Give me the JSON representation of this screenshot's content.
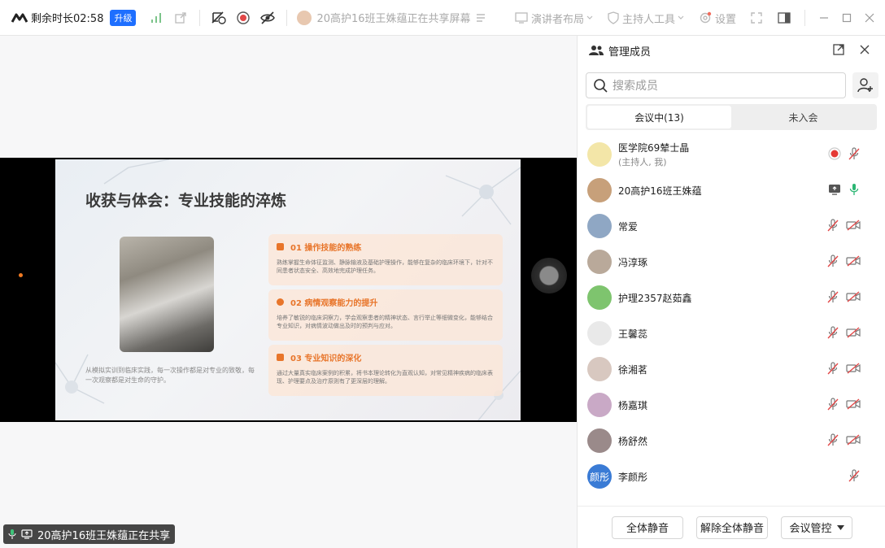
{
  "topbar": {
    "timer": "剩余时长02:58",
    "upgrade": "升级",
    "share_status": "20高护16班王姝蕴正在共享屏幕",
    "presenter_layout": "演讲者布局",
    "host_tools": "主持人工具",
    "settings": "设置"
  },
  "slide": {
    "title": "收获与体会：专业技能的淬炼",
    "caption": "从模拟实训到临床实践，每一次操作都是对专业的致敬，每一次观察都是对生命的守护。",
    "cards": [
      {
        "heading": "01 操作技能的熟练",
        "text": "熟练掌握生命体征监测、静脉输液及基础护理操作，能够在复杂的临床环境下，针对不同患者状态安全、高效地完成护理任务。"
      },
      {
        "heading": "02 病情观察能力的提升",
        "text": "培养了敏锐的临床洞察力，学会观察患者的精神状态、言行举止等细微变化，能够结合专业知识，对病情波动做出及时的预判与应对。"
      },
      {
        "heading": "03 专业知识的深化",
        "text": "通过大量真实临床案例的积累，将书本理论转化为直观认知，对常见精神疾病的临床表现、护理要点及治疗原则有了更深层的理解。"
      }
    ]
  },
  "status_pill": "20高护16班王姝蕴正在共享",
  "sidebar": {
    "title": "管理成员",
    "search_placeholder": "搜索成员",
    "tabs": [
      "会议中(13)",
      "未入会"
    ],
    "members": [
      {
        "name": "医学院69辇士晶",
        "sub": "(主持人, 我)",
        "avatar_color": "#f3e6a8",
        "avatar_text": "",
        "icons": [
          "record",
          "mic-off"
        ]
      },
      {
        "name": "20高护16班王姝蕴",
        "sub": "",
        "avatar_color": "#c7a07a",
        "avatar_text": "",
        "icons": [
          "screen-share",
          "mic-on"
        ]
      },
      {
        "name": "常爱",
        "sub": "",
        "avatar_color": "#8fa7c4",
        "avatar_text": "",
        "icons": [
          "mic-off",
          "cam-off"
        ]
      },
      {
        "name": "冯淳琢",
        "sub": "",
        "avatar_color": "#b9a99a",
        "avatar_text": "",
        "icons": [
          "mic-off",
          "cam-off"
        ]
      },
      {
        "name": "护理2357赵茹鑫",
        "sub": "",
        "avatar_color": "#7ec46e",
        "avatar_text": "",
        "icons": [
          "mic-off",
          "cam-off"
        ]
      },
      {
        "name": "王馨蕊",
        "sub": "",
        "avatar_color": "#e9e9e9",
        "avatar_text": "",
        "icons": [
          "mic-off",
          "cam-off"
        ]
      },
      {
        "name": "徐湘茗",
        "sub": "",
        "avatar_color": "#d8c8c0",
        "avatar_text": "",
        "icons": [
          "mic-off",
          "cam-off"
        ]
      },
      {
        "name": "杨嘉琪",
        "sub": "",
        "avatar_color": "#c9a9c6",
        "avatar_text": "",
        "icons": [
          "mic-off",
          "cam-off"
        ]
      },
      {
        "name": "杨舒然",
        "sub": "",
        "avatar_color": "#9a8a8a",
        "avatar_text": "",
        "icons": [
          "mic-off",
          "cam-off"
        ]
      },
      {
        "name": "李颜彤",
        "sub": "",
        "avatar_color": "#3a7bd5",
        "avatar_text": "颜彤",
        "icons": [
          "mic-off"
        ]
      }
    ],
    "footer": {
      "mute_all": "全体静音",
      "unmute_all": "解除全体静音",
      "meeting_control": "会议管控"
    }
  },
  "colors": {
    "accent": "#1e6fff",
    "muted_red": "#e24848",
    "mic_green": "#2bb673",
    "orange": "#e8752a"
  }
}
